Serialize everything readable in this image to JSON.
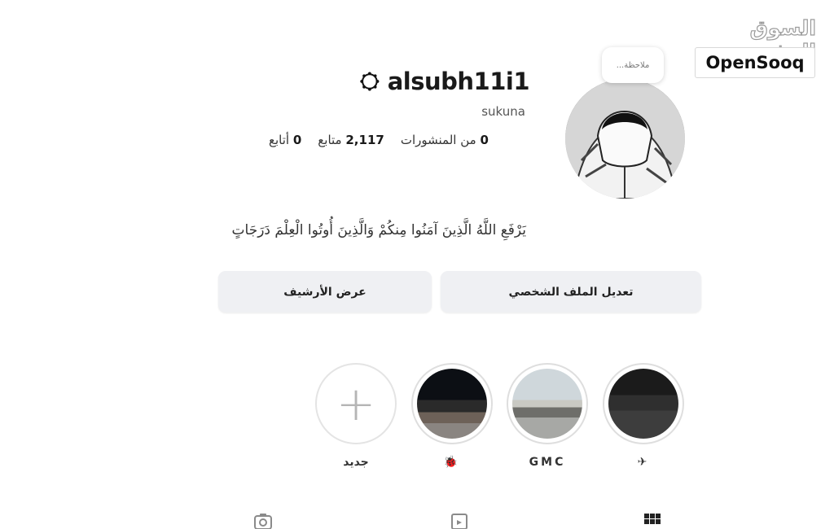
{
  "watermark": {
    "arabic": "السوق المفتوح",
    "brand": "OpenSooq"
  },
  "profile": {
    "note_placeholder": "ملاحظة...",
    "username": "alsubh11i1",
    "full_name": "sukuna",
    "stats": {
      "posts": {
        "count": "0",
        "label": "من المنشورات"
      },
      "followers": {
        "count": "2,117",
        "label": "متابع"
      },
      "following": {
        "count": "0",
        "label": "أتابع"
      }
    },
    "bio": "يَرْفَعِ اللَّهُ الَّذِينَ آمَنُوا مِنكُمْ وَالَّذِينَ أُوتُوا الْعِلْمَ دَرَجَاتٍ"
  },
  "buttons": {
    "edit_profile": "تعديل الملف الشخصي",
    "view_archive": "عرض الأرشيف"
  },
  "highlights": [
    {
      "label": "✈"
    },
    {
      "label": "GMC"
    },
    {
      "label": "🐞"
    },
    {
      "label": "جديد"
    }
  ],
  "tabs": [
    "grid-icon",
    "reels-icon",
    "tagged-icon"
  ]
}
